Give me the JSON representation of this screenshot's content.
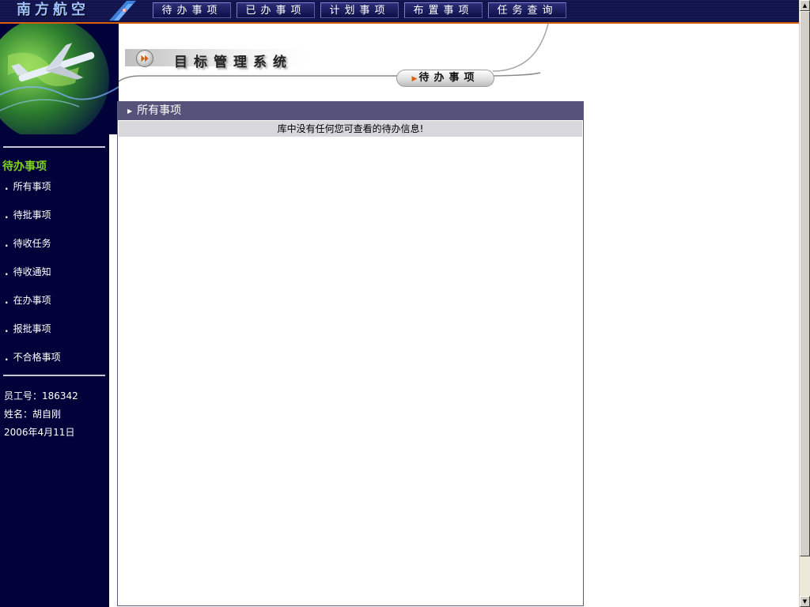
{
  "brand": {
    "name": "南方航空",
    "logo_icon": "china-southern-logo-icon"
  },
  "nav": [
    {
      "label": "待办事项"
    },
    {
      "label": "已办事项"
    },
    {
      "label": "计划事项"
    },
    {
      "label": "布置事项"
    },
    {
      "label": "任务查询"
    }
  ],
  "header": {
    "system_title": "目标管理系统",
    "current_tab": "待办事项"
  },
  "sidebar": {
    "title": "待办事项",
    "items": [
      {
        "label": "所有事项"
      },
      {
        "label": "待批事项"
      },
      {
        "label": "待收任务"
      },
      {
        "label": "待收通知"
      },
      {
        "label": "在办事项"
      },
      {
        "label": "报批事项"
      },
      {
        "label": "不合格事项"
      }
    ],
    "employee_id": "员工号：186342",
    "name": "姓名：胡自刚",
    "date": "2006年4月11日"
  },
  "panel": {
    "title": "所有事项",
    "message": "库中没有任何您可查看的待办信息!"
  },
  "colors": {
    "nav_bg": "#0b0d40",
    "sidebar_bg": "#02023a",
    "accent_orange": "#d85f10",
    "sidebar_title": "#7fcf1e",
    "panel_header": "#55537a",
    "message_bg": "#d7d7dc"
  }
}
